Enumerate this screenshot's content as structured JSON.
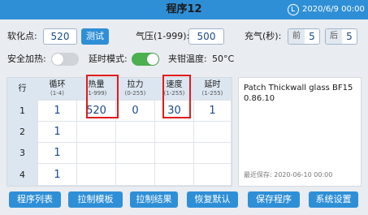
{
  "header": {
    "title": "程序12",
    "datetime": "2020/6/9 00:00"
  },
  "controls": {
    "softening_label": "软化点:",
    "softening_value": "520",
    "test_button": "测试",
    "pressure_label": "气压(1-999):",
    "pressure_value": "500",
    "inflate_label": "充气(秒):",
    "front_label": "前",
    "front_value": "5",
    "back_label": "后",
    "back_value": "5",
    "safety_heat_label": "安全加热:",
    "safety_heat_on": false,
    "delay_mode_label": "延时模式:",
    "delay_mode_on": true,
    "clamp_temp_label": "夹钳温度:",
    "clamp_temp_value": "50°C"
  },
  "table": {
    "columns": [
      {
        "name": "行",
        "range": ""
      },
      {
        "name": "循环",
        "range": "(1-4)"
      },
      {
        "name": "热量",
        "range": "(1-999)"
      },
      {
        "name": "拉力",
        "range": "(0-255)"
      },
      {
        "name": "速度",
        "range": "(1-255)"
      },
      {
        "name": "延时",
        "range": "(1-255)"
      }
    ],
    "rows": [
      {
        "row": "1",
        "cycle": "1",
        "heat": "520",
        "pull": "0",
        "speed": "30",
        "delay": "1"
      },
      {
        "row": "2",
        "cycle": "1",
        "heat": "",
        "pull": "",
        "speed": "",
        "delay": ""
      },
      {
        "row": "3",
        "cycle": "1",
        "heat": "",
        "pull": "",
        "speed": "",
        "delay": ""
      },
      {
        "row": "4",
        "cycle": "1",
        "heat": "",
        "pull": "",
        "speed": "",
        "delay": ""
      }
    ]
  },
  "note": {
    "text": "Patch Thickwall glass BF150.86.10",
    "last_saved": "最近保存: 2020-06-10 00:00"
  },
  "buttons": [
    "程序列表",
    "拉制模板",
    "拉制结果",
    "恢复默认",
    "保存程序",
    "系统设置"
  ],
  "colors": {
    "accent": "#2f8fd6",
    "toggle_on": "#4caf50",
    "highlight": "#e01b1b"
  }
}
